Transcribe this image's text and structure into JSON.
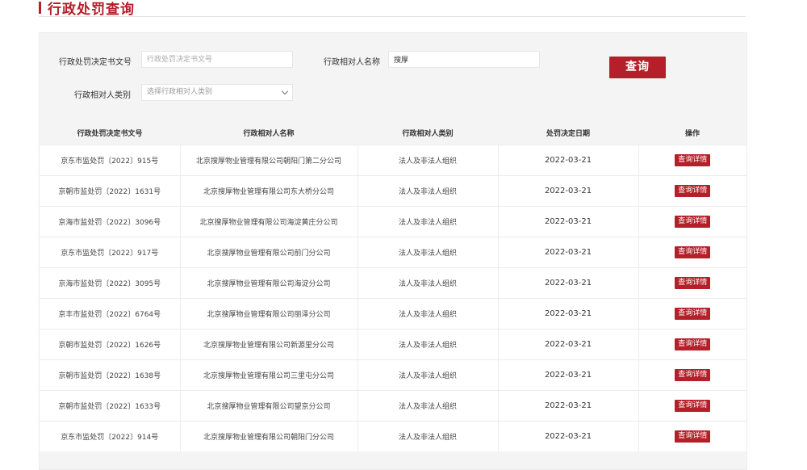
{
  "page_title": "行政处罚查询",
  "search": {
    "doc_no_label": "行政处罚决定书文号",
    "doc_no_placeholder": "行政处罚决定书文号",
    "doc_no_value": "",
    "party_name_label": "行政相对人名称",
    "party_name_value": "搜厚",
    "party_type_label": "行政相对人类别",
    "party_type_placeholder": "选择行政相对人类别",
    "search_button": "查询"
  },
  "table": {
    "headers": [
      "行政处罚决定书文号",
      "行政相对人名称",
      "行政相对人类别",
      "处罚决定日期",
      "操作"
    ],
    "rows": [
      {
        "doc_no": "京东市监处罚〔2022〕915号",
        "party": "北京搜厚物业管理有限公司朝阳门第二分公司",
        "type": "法人及非法人组织",
        "date": "2022-03-21",
        "action": "查询详情"
      },
      {
        "doc_no": "京朝市监处罚〔2022〕1631号",
        "party": "北京搜厚物业管理有限公司东大桥分公司",
        "type": "法人及非法人组织",
        "date": "2022-03-21",
        "action": "查询详情"
      },
      {
        "doc_no": "京海市监处罚〔2022〕3096号",
        "party": "北京搜厚物业管理有限公司海淀黄庄分公司",
        "type": "法人及非法人组织",
        "date": "2022-03-21",
        "action": "查询详情"
      },
      {
        "doc_no": "京东市监处罚〔2022〕917号",
        "party": "北京搜厚物业管理有限公司前门分公司",
        "type": "法人及非法人组织",
        "date": "2022-03-21",
        "action": "查询详情"
      },
      {
        "doc_no": "京海市监处罚〔2022〕3095号",
        "party": "北京搜厚物业管理有限公司海淀分公司",
        "type": "法人及非法人组织",
        "date": "2022-03-21",
        "action": "查询详情"
      },
      {
        "doc_no": "京丰市监处罚〔2022〕6764号",
        "party": "北京搜厚物业管理有限公司丽泽分公司",
        "type": "法人及非法人组织",
        "date": "2022-03-21",
        "action": "查询详情"
      },
      {
        "doc_no": "京朝市监处罚〔2022〕1626号",
        "party": "北京搜厚物业管理有限公司新源里分公司",
        "type": "法人及非法人组织",
        "date": "2022-03-21",
        "action": "查询详情"
      },
      {
        "doc_no": "京朝市监处罚〔2022〕1638号",
        "party": "北京搜厚物业管理有限公司三里屯分公司",
        "type": "法人及非法人组织",
        "date": "2022-03-21",
        "action": "查询详情"
      },
      {
        "doc_no": "京朝市监处罚〔2022〕1633号",
        "party": "北京搜厚物业管理有限公司望京分公司",
        "type": "法人及非法人组织",
        "date": "2022-03-21",
        "action": "查询详情"
      },
      {
        "doc_no": "京东市监处罚〔2022〕914号",
        "party": "北京搜厚物业管理有限公司朝阳门分公司",
        "type": "法人及非法人组织",
        "date": "2022-03-21",
        "action": "查询详情"
      }
    ]
  },
  "colors": {
    "accent": "#b51f29",
    "panel_bg": "#f4f4f4"
  }
}
